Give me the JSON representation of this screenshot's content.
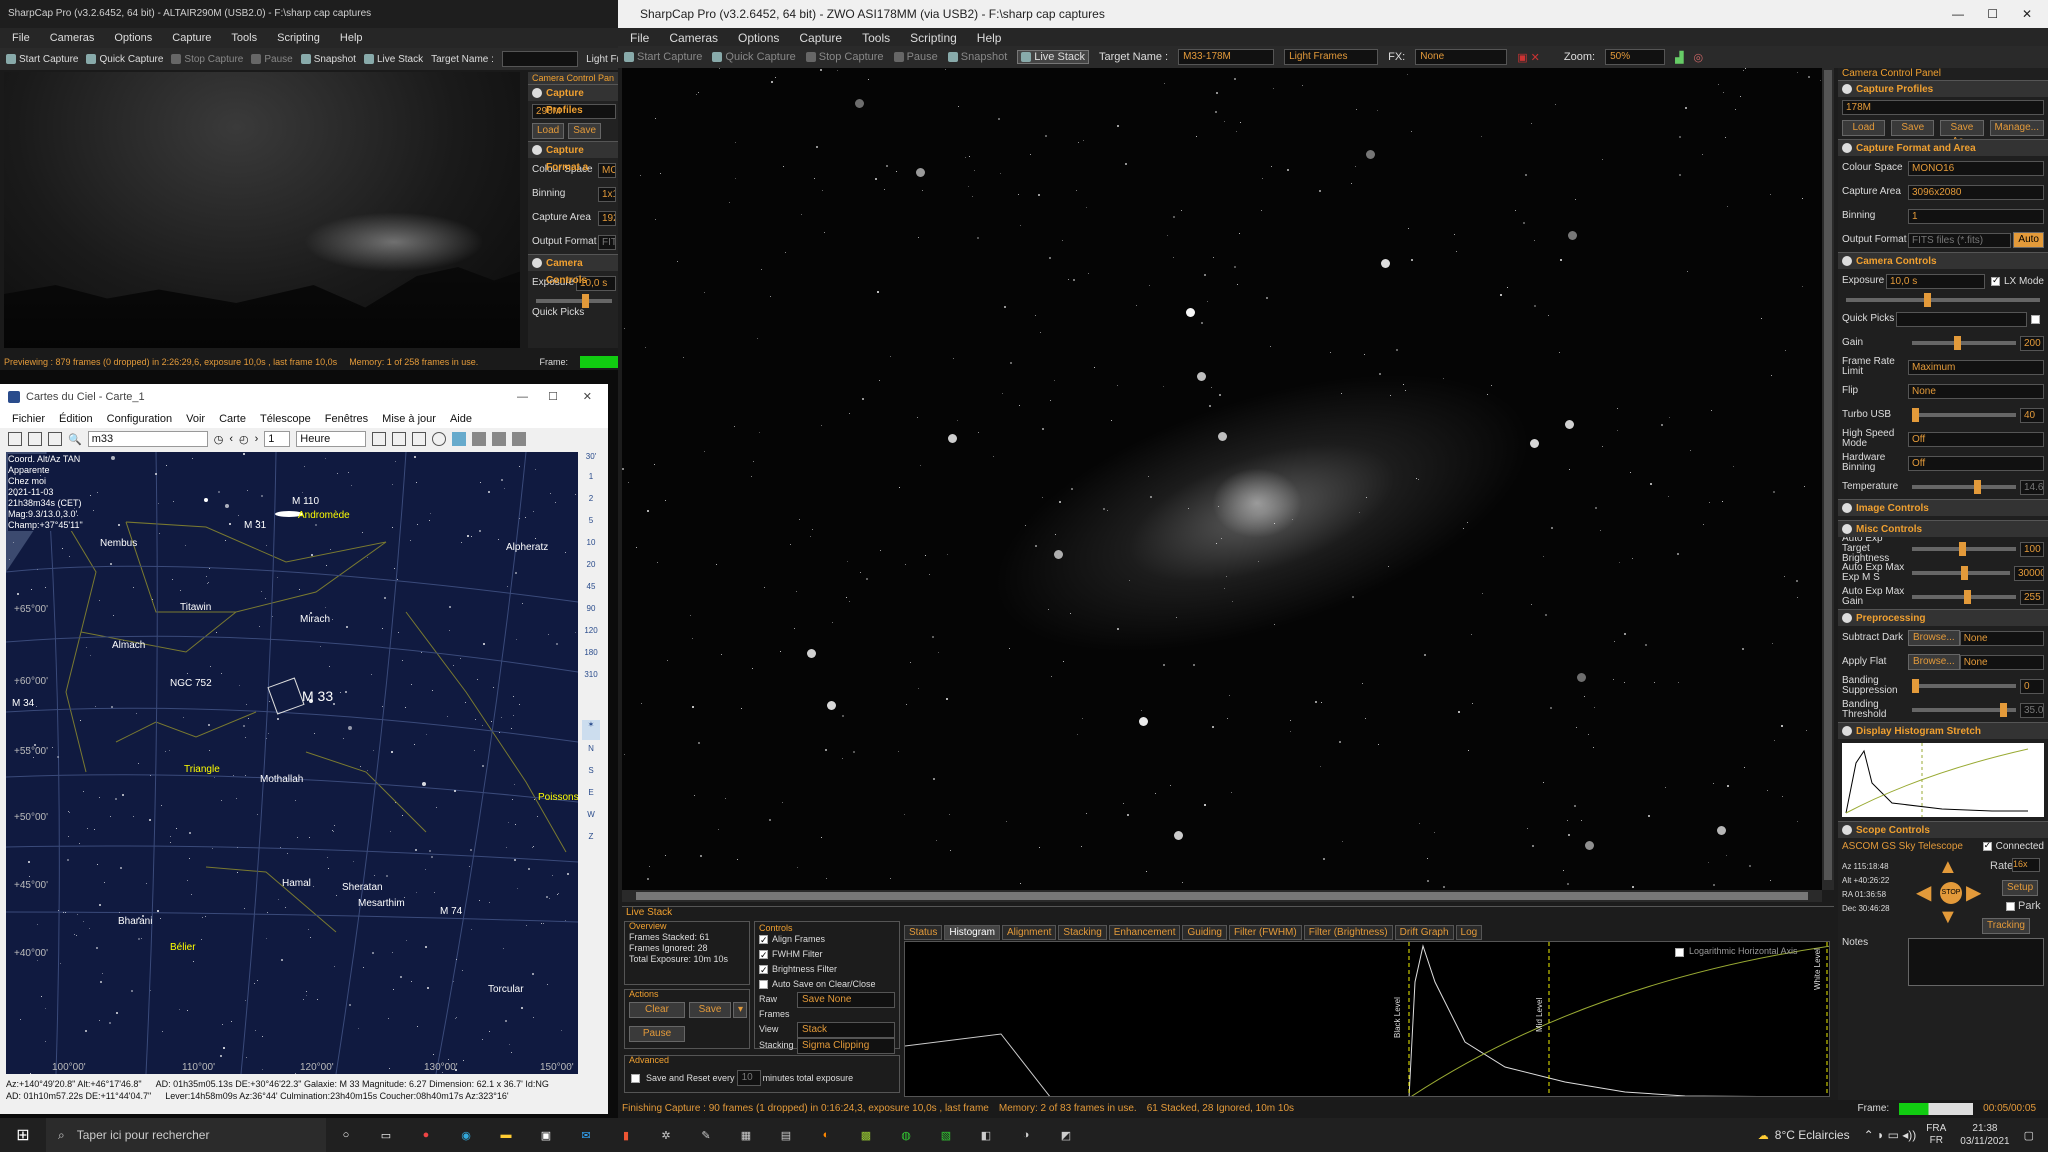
{
  "left_sharpcap": {
    "title": "SharpCap Pro (v3.2.6452, 64 bit) - ALTAIR290M (USB2.0) - F:\\sharp cap captures",
    "menu": [
      "File",
      "Cameras",
      "Options",
      "Capture",
      "Tools",
      "Scripting",
      "Help"
    ],
    "toolbar": {
      "start": "Start Capture",
      "quick": "Quick Capture",
      "stop": "Stop Capture",
      "pause": "Pause",
      "snapshot": "Snapshot",
      "live_stack": "Live Stack",
      "target_label": "Target Name :",
      "frame_type": "Light Fr"
    },
    "panel_title": "Camera Control Pan",
    "profiles_hdr": "Capture Profiles",
    "profile": "290M",
    "load": "Load",
    "save": "Save",
    "format_hdr": "Capture Format a",
    "colour_space_lbl": "Colour Space",
    "colour_space": "MO",
    "binning_lbl": "Binning",
    "binning": "1x1",
    "capture_area_lbl": "Capture Area",
    "capture_area": "192",
    "output_format_lbl": "Output Format",
    "output_format": "FITS",
    "cam_ctrl_hdr": "Camera Controls",
    "exposure_lbl": "Exposure",
    "exposure": "10,0 s",
    "quick_picks_lbl": "Quick Picks",
    "status": "Previewing : 879 frames (0 dropped) in 2:26:29,6, exposure 10,0s , last frame 10,0s",
    "memory": "Memory: 1 of 258 frames in use.",
    "frame_lbl": "Frame:"
  },
  "cdc": {
    "title": "Cartes du Ciel - Carte_1",
    "menu": [
      "Fichier",
      "Édition",
      "Configuration",
      "Voir",
      "Carte",
      "Télescope",
      "Fenêtres",
      "Mise à jour",
      "Aide"
    ],
    "search": "m33",
    "step": "1",
    "unit": "Heure",
    "info": [
      "Coord. Alt/Az TAN",
      "Apparente",
      "Chez moi",
      "2021-11-03",
      "21h38m34s (CET)",
      "Mag:9.3/13.0,3.0'",
      "Champ:+37°45'11\""
    ],
    "labels": {
      "m110": "M 110",
      "andromede": "Andromède",
      "m31": "M 31",
      "nembus": "Nembus",
      "alpheratz": "Alpheratz",
      "titawin": "Titawin",
      "mirach": "Mirach",
      "almach": "Almach",
      "ngc752": "NGC 752",
      "m34": "M 34",
      "m33": "M 33",
      "triangle": "Triangle",
      "mothallah": "Mothallah",
      "poissons": "Poissons",
      "hamal": "Hamal",
      "sheratan": "Sheratan",
      "mesarthim": "Mesarthim",
      "m74": "M 74",
      "bharani": "Bharani",
      "belier": "Bélier",
      "torcular": "Torcular"
    },
    "dec_labels": [
      "+65°00'",
      "+60°00'",
      "+55°00'",
      "+50°00'",
      "+45°00'",
      "+40°00'"
    ],
    "ra_labels": [
      "150°00'",
      "140°00'",
      "130°00'",
      "120°00'",
      "110°00'",
      "100°00'"
    ],
    "scale_labels": [
      "30'",
      "1",
      "2",
      "5",
      "10",
      "20",
      "45",
      "90",
      "120",
      "180",
      "310"
    ],
    "compass": [
      "N",
      "S",
      "E",
      "W",
      "Z"
    ],
    "status1": "Az:+140°49'20.8\" Alt:+46°17'46.8\"",
    "status2": "AD: 01h10m57.22s DE:+11°44'04.7\"",
    "status3": "AD: 01h35m05.13s DE:+30°46'22.3\"  Galaxie: M 33  Magnitude: 6.27  Dimension: 62.1 x 36.7'  Id:NG",
    "status4": "Lever:14h58m09s Az:36°44'  Culmination:23h40m15s  Coucher:08h40m17s Az:323°16'"
  },
  "main": {
    "title": "SharpCap Pro (v3.2.6452, 64 bit) - ZWO ASI178MM (via USB2) - F:\\sharp cap captures",
    "menu": [
      "File",
      "Cameras",
      "Options",
      "Capture",
      "Tools",
      "Scripting",
      "Help"
    ],
    "toolbar": {
      "start": "Start Capture",
      "quick": "Quick Capture",
      "stop": "Stop Capture",
      "pause": "Pause",
      "snapshot": "Snapshot",
      "live_stack": "Live Stack",
      "target_label": "Target Name :",
      "target": "M33-178M",
      "frame_type": "Light Frames",
      "fx_label": "FX:",
      "fx": "None",
      "zoom_label": "Zoom:",
      "zoom": "50%"
    },
    "panel": {
      "title": "Camera Control Panel",
      "profiles_hdr": "Capture Profiles",
      "profile": "178M",
      "load": "Load",
      "save": "Save",
      "save_as": "Save As...",
      "manage": "Manage...",
      "format_hdr": "Capture Format and Area",
      "colour_space_lbl": "Colour Space",
      "colour_space": "MONO16",
      "capture_area_lbl": "Capture Area",
      "capture_area": "3096x2080",
      "binning_lbl": "Binning",
      "binning": "1",
      "output_format_lbl": "Output Format",
      "output_format": "FITS files (*.fits)",
      "auto": "Auto",
      "cam_ctrl_hdr": "Camera Controls",
      "exposure_lbl": "Exposure",
      "exposure": "10,0 s",
      "lx_mode": "LX Mode",
      "quick_picks_lbl": "Quick Picks",
      "gain_lbl": "Gain",
      "gain": "200",
      "frame_rate_lbl": "Frame Rate Limit",
      "frame_rate": "Maximum",
      "flip_lbl": "Flip",
      "flip": "None",
      "turbo_lbl": "Turbo USB",
      "turbo": "40",
      "high_speed_lbl": "High Speed Mode",
      "high_speed": "Off",
      "hw_bin_lbl": "Hardware Binning",
      "hw_bin": "Off",
      "temp_lbl": "Temperature",
      "temp": "14.6",
      "image_ctrl_hdr": "Image Controls",
      "misc_hdr": "Misc Controls",
      "auto_exp_target_lbl": "Auto Exp Target Brightness",
      "auto_exp_target": "100",
      "auto_exp_max_lbl": "Auto Exp Max Exp M S",
      "auto_exp_max": "30000",
      "auto_exp_gain_lbl": "Auto Exp Max Gain",
      "auto_exp_gain": "255",
      "preproc_hdr": "Preprocessing",
      "subtract_dark_lbl": "Subtract Dark",
      "apply_flat_lbl": "Apply Flat",
      "browse": "Browse...",
      "none": "None",
      "banding_sup_lbl": "Banding Suppression",
      "banding_sup": "0",
      "banding_thr_lbl": "Banding Threshold",
      "banding_thr": "35.0",
      "hist_hdr": "Display Histogram Stretch",
      "scope_hdr": "Scope Controls",
      "scope_name": "ASCOM GS Sky Telescope",
      "connected": "Connected",
      "rate_lbl": "Rate:",
      "rate": "16x",
      "setup": "Setup",
      "park": "Park",
      "stop": "STOP",
      "tracking": "Tracking",
      "coords": [
        "Az 115:18:48",
        "Alt +40:26:22",
        "RA 01:36:58",
        "Dec 30:46:28"
      ],
      "notes_lbl": "Notes"
    },
    "live_stack": {
      "title": "Live Stack",
      "overview_hdr": "Overview",
      "frames_stacked": "Frames Stacked: 61",
      "frames_ignored": "Frames Ignored:  28",
      "total_exposure": "Total Exposure:  10m 10s",
      "actions_hdr": "Actions",
      "clear": "Clear",
      "save": "Save",
      "pause": "Pause",
      "controls_hdr": "Controls",
      "align": "Align Frames",
      "fwhm": "FWHM Filter",
      "brightness": "Brightness Filter",
      "autosave": "Auto Save on Clear/Close",
      "raw_frames_lbl": "Raw Frames",
      "raw_frames": "Save None",
      "view_lbl": "View",
      "view": "Stack",
      "stacking_lbl": "Stacking",
      "stacking": "Sigma Clipping",
      "advanced_hdr": "Advanced",
      "save_reset": "Save and Reset every",
      "minutes": "10",
      "minutes_lbl": "minutes total exposure",
      "tabs": [
        "Status",
        "Histogram",
        "Alignment",
        "Stacking",
        "Enhancement",
        "Guiding",
        "Filter (FWHM)",
        "Filter (Brightness)",
        "Drift Graph",
        "Log"
      ],
      "log_axis": "Logarithmic Horizontal Axis",
      "black_level": "Black Level",
      "mid_level": "Mid Level",
      "white_level": "White Level"
    },
    "status": "Finishing Capture : 90 frames (1 dropped) in 0:16:24,3, exposure 10,0s , last frame",
    "memory": "Memory: 2 of 83 frames in use.",
    "stacked": "61 Stacked, 28 Ignored, 10m 10s",
    "frame_lbl": "Frame:",
    "frame_time": "00:05/00:05"
  },
  "taskbar": {
    "search": "Taper ici pour rechercher",
    "weather": "8°C  Eclaircies",
    "lang1": "FRA",
    "lang2": "FR",
    "time": "21:38",
    "date": "03/11/2021"
  }
}
